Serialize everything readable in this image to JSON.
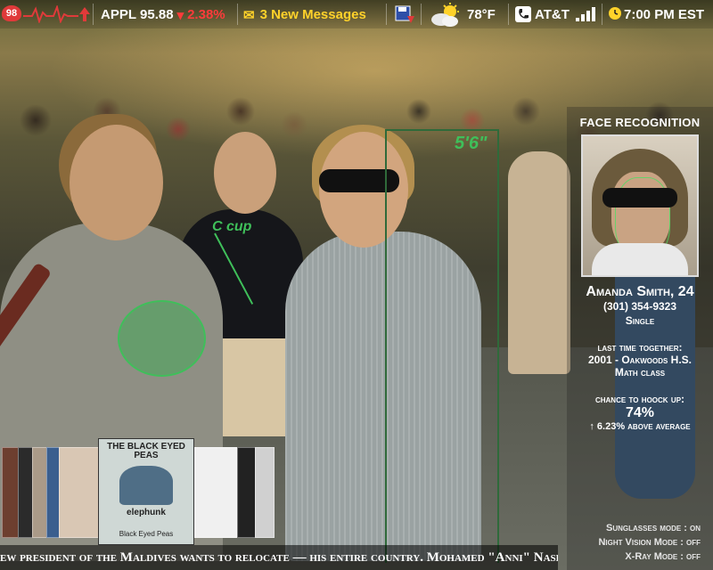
{
  "status_bar": {
    "heart_rate": "98",
    "stock": {
      "symbol": "APPL",
      "price": "95.88",
      "change": "2.38%"
    },
    "messages": "3 New Messages",
    "temperature": "78°F",
    "carrier": "AT&T",
    "time": "7:00 PM EST"
  },
  "annotations": {
    "height": "5'6\"",
    "cup": "C cup"
  },
  "face_panel": {
    "title": "FACE RECOGNITION",
    "name": "Amanda Smith, 24",
    "phone": "(301) 354-9323",
    "status": "Single",
    "last_label": "last time together:",
    "last_value": "2001 - Oakwoods H.S.",
    "last_detail": "Math class",
    "chance_label": "chance to hoock up:",
    "chance_value": "74%",
    "chance_delta": "6.23% above average"
  },
  "modes": [
    "Sunglasses mode : on",
    "Night Vision Mode : off",
    "X-Ray Mode : off"
  ],
  "album": {
    "band": "THE BLACK EYED PEAS",
    "title": "elephunk",
    "subtitle": "Black Eyed Peas"
  },
  "ticker": "ew president of the Maldives wants to relocate — his entire country. Mohamed \"Anni\" Nasheed",
  "colors": {
    "accent_green": "#3fbf5a",
    "messages_yellow": "#ffd22a",
    "stock_down_red": "#ff3b3b"
  }
}
